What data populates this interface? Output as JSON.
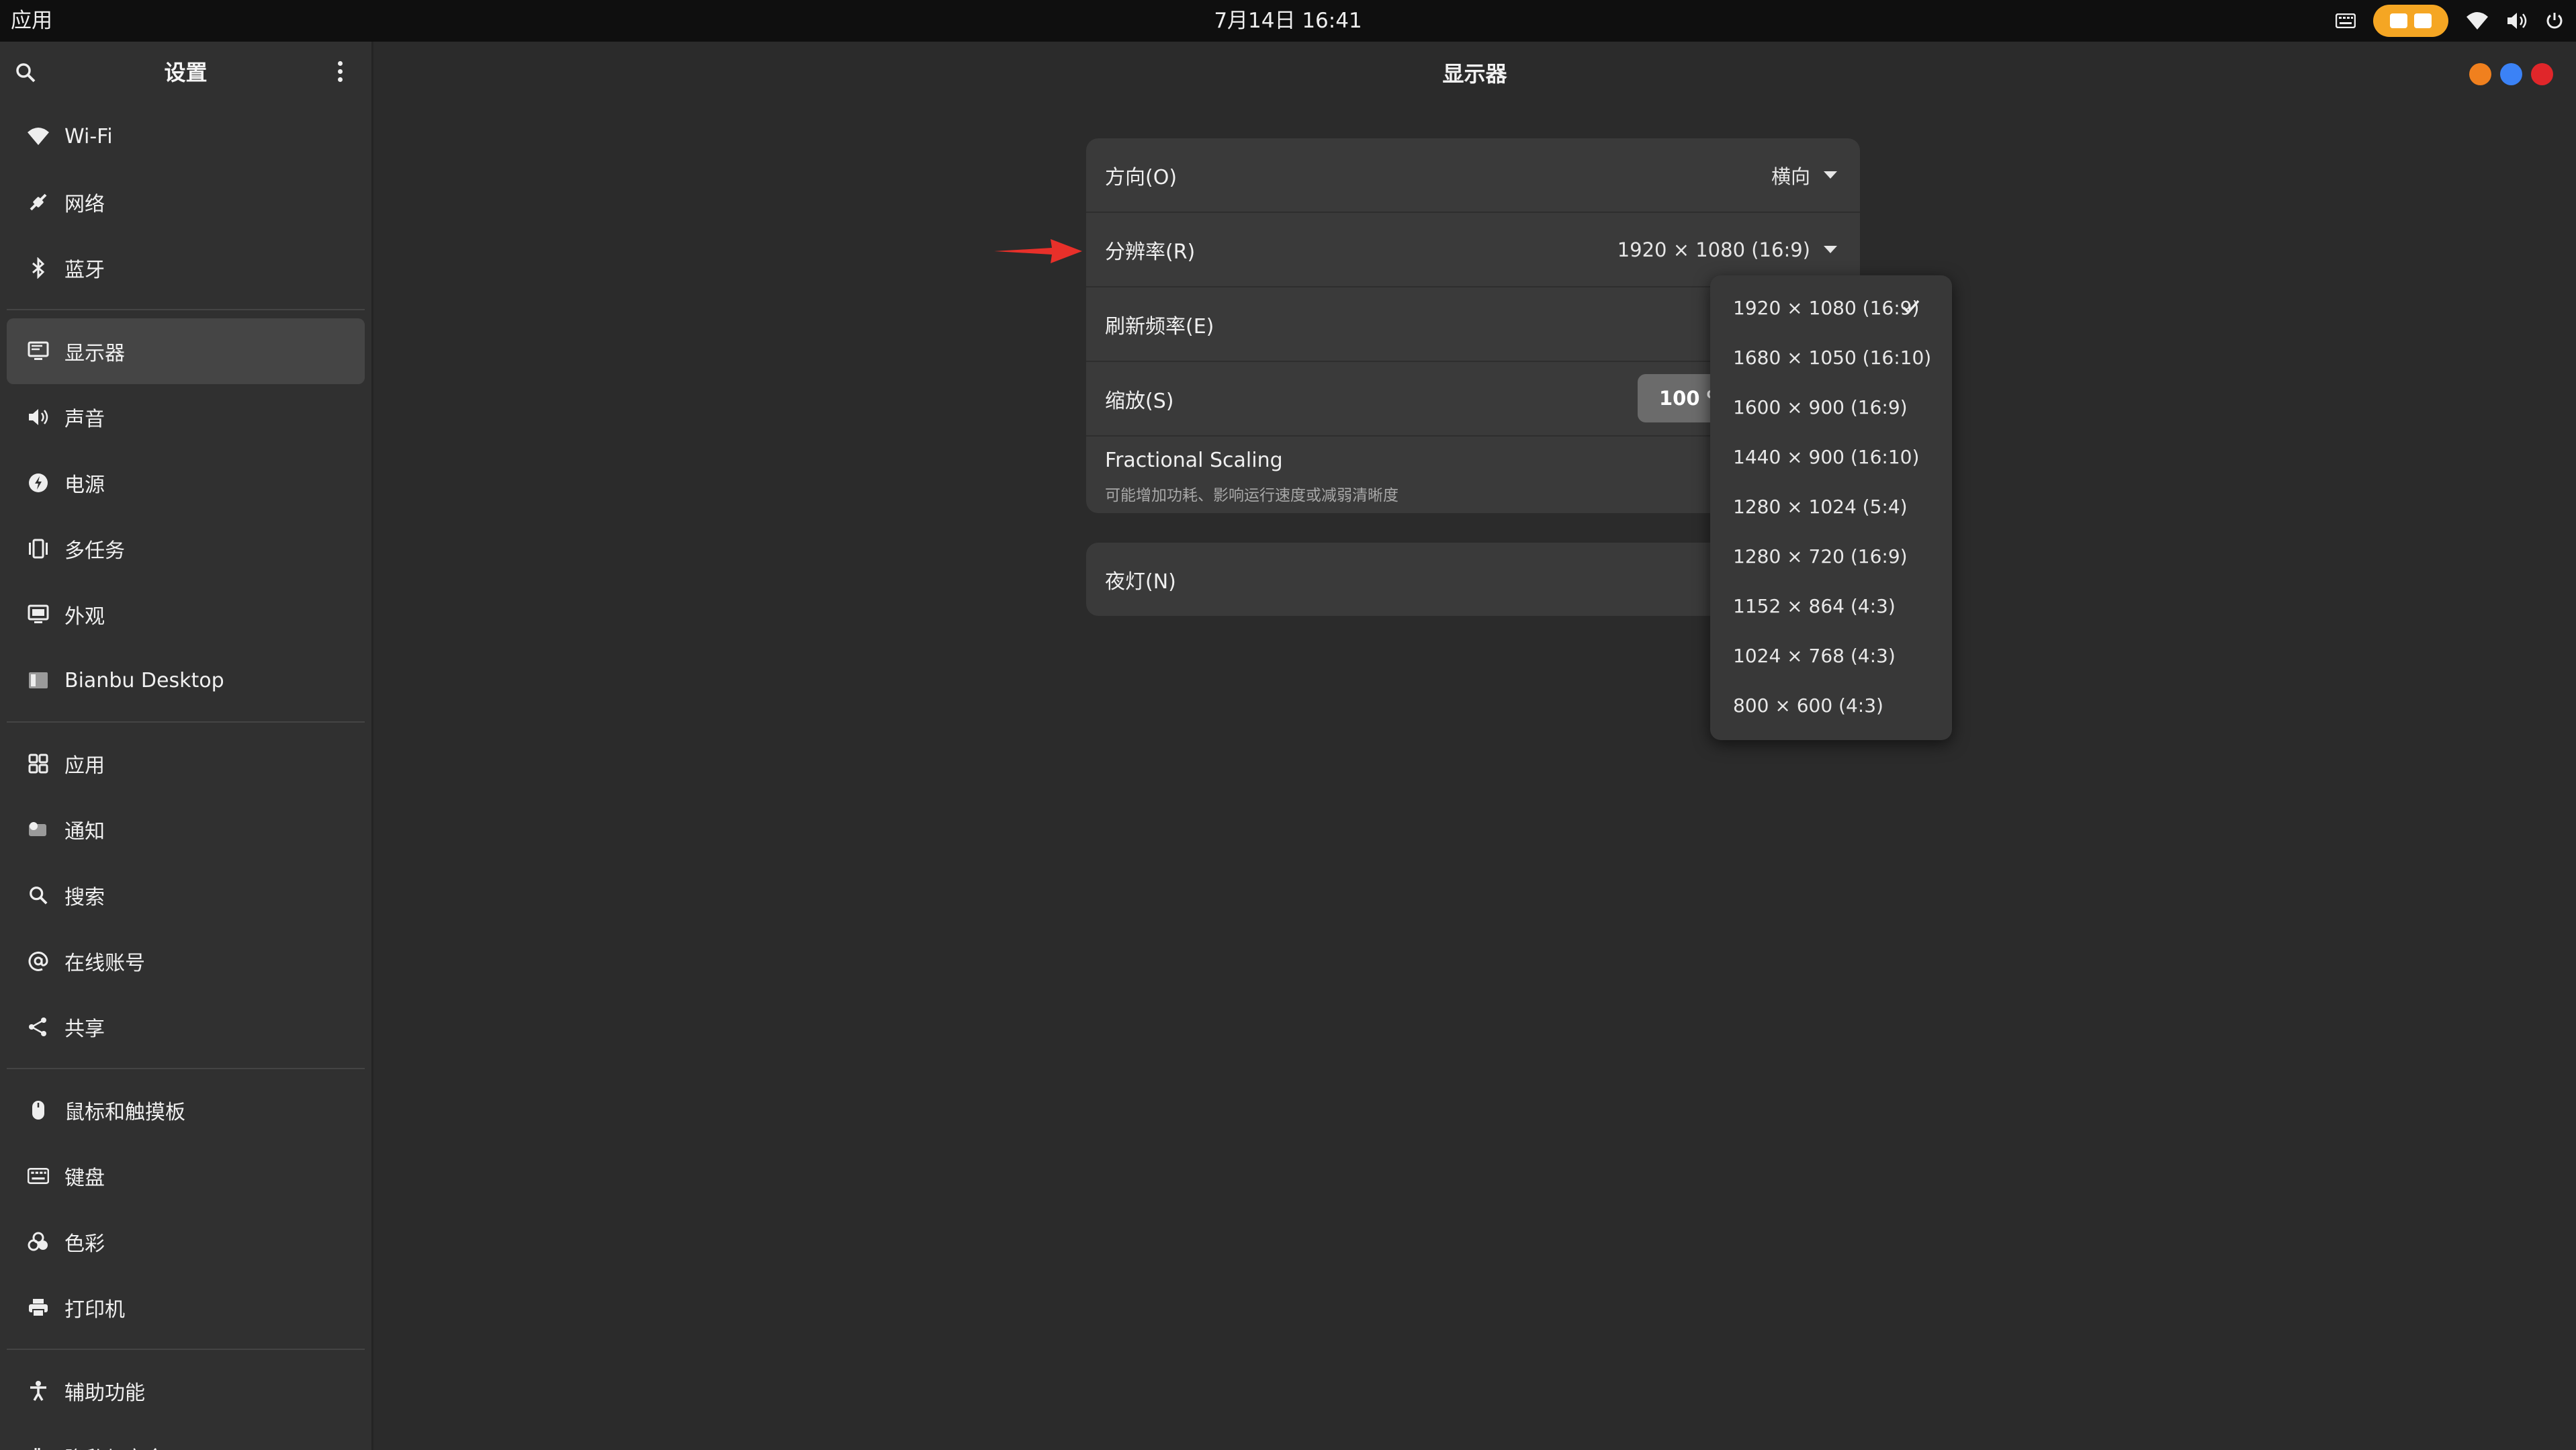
{
  "topbar": {
    "apps_label": "应用",
    "datetime": "7月14日  16:41",
    "tray_icons": [
      "keyboard-icon",
      "screen-share-indicator",
      "wifi-icon",
      "volume-icon",
      "power-icon"
    ]
  },
  "sidebar": {
    "title": "设置",
    "groups": [
      [
        {
          "label": "Wi-Fi",
          "icon": "wifi-icon"
        },
        {
          "label": "网络",
          "icon": "network-icon"
        },
        {
          "label": "蓝牙",
          "icon": "bluetooth-icon"
        }
      ],
      [
        {
          "label": "显示器",
          "icon": "display-icon",
          "active": true
        },
        {
          "label": "声音",
          "icon": "speaker-icon"
        },
        {
          "label": "电源",
          "icon": "power-icon"
        },
        {
          "label": "多任务",
          "icon": "multitask-icon"
        },
        {
          "label": "外观",
          "icon": "appearance-icon"
        },
        {
          "label": "Bianbu Desktop",
          "icon": "desktop-icon"
        }
      ],
      [
        {
          "label": "应用",
          "icon": "apps-grid-icon"
        },
        {
          "label": "通知",
          "icon": "notification-icon"
        },
        {
          "label": "搜索",
          "icon": "search-icon"
        },
        {
          "label": "在线账号",
          "icon": "at-icon"
        },
        {
          "label": "共享",
          "icon": "share-icon"
        }
      ],
      [
        {
          "label": "鼠标和触摸板",
          "icon": "mouse-icon"
        },
        {
          "label": "键盘",
          "icon": "keyboard-icon"
        },
        {
          "label": "色彩",
          "icon": "color-icon"
        },
        {
          "label": "打印机",
          "icon": "printer-icon"
        }
      ],
      [
        {
          "label": "辅助功能",
          "icon": "accessibility-icon"
        },
        {
          "label": "隐私与安全",
          "icon": "privacy-icon"
        }
      ]
    ]
  },
  "main": {
    "title": "显示器",
    "window_controls": {
      "minimize": "#f0801e",
      "maximize": "#3b82f6",
      "close": "#e0262a"
    },
    "orientation": {
      "label": "方向(O)",
      "value": "横向"
    },
    "resolution": {
      "label": "分辨率(R)",
      "value": "1920 × 1080 (16:9)"
    },
    "refresh": {
      "label": "刷新频率(E)"
    },
    "scale": {
      "label": "缩放(S)",
      "value": "100 %"
    },
    "fractional": {
      "title": "Fractional Scaling",
      "subtitle": "可能增加功耗、影响运行速度或减弱清晰度"
    },
    "night_light": {
      "label": "夜灯(N)"
    }
  },
  "resolution_dropdown": {
    "options": [
      {
        "label": "1920 × 1080 (16:9)",
        "selected": true
      },
      {
        "label": "1680 × 1050 (16:10)"
      },
      {
        "label": "1600 × 900 (16:9)"
      },
      {
        "label": "1440 × 900 (16:10)"
      },
      {
        "label": "1280 × 1024 (5:4)"
      },
      {
        "label": "1280 × 720 (16:9)"
      },
      {
        "label": "1152 × 864 (4:3)"
      },
      {
        "label": "1024 × 768 (4:3)"
      },
      {
        "label": "800 × 600 (4:3)"
      }
    ]
  },
  "colors": {
    "annotation_arrow": "#e8302a",
    "accent_tray": "#f5a623"
  }
}
